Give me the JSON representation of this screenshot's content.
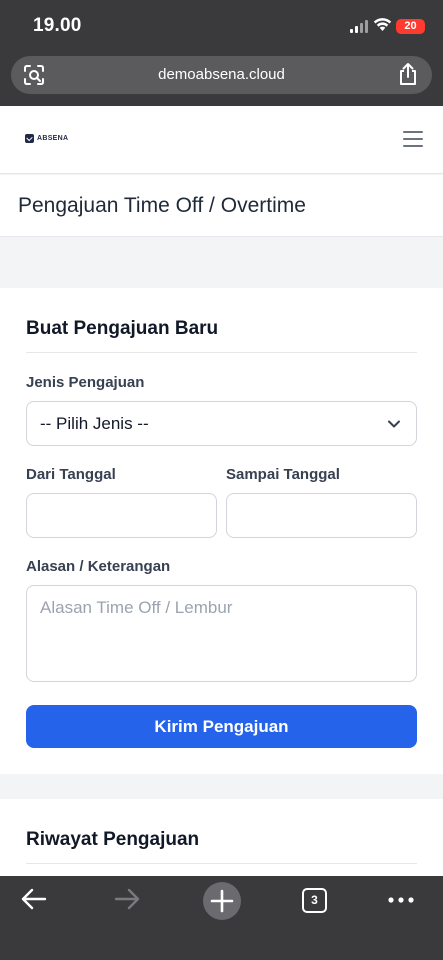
{
  "status_bar": {
    "time": "19.00",
    "battery": "20"
  },
  "browser": {
    "url": "demoabsena.cloud",
    "open_tabs": "3"
  },
  "navbar": {
    "brand": "ABSENA"
  },
  "page": {
    "title": "Pengajuan Time Off / Overtime"
  },
  "form": {
    "heading": "Buat Pengajuan Baru",
    "type_label": "Jenis Pengajuan",
    "type_value": "-- Pilih Jenis --",
    "from_label": "Dari Tanggal",
    "from_value": "",
    "to_label": "Sampai Tanggal",
    "to_value": "",
    "reason_label": "Alasan / Keterangan",
    "reason_placeholder": "Alasan Time Off / Lembur",
    "submit_label": "Kirim Pengajuan"
  },
  "history": {
    "heading": "Riwayat Pengajuan"
  },
  "colors": {
    "primary": "#2563eb",
    "chrome": "#3a3a3c",
    "battery": "#ff3b30"
  }
}
